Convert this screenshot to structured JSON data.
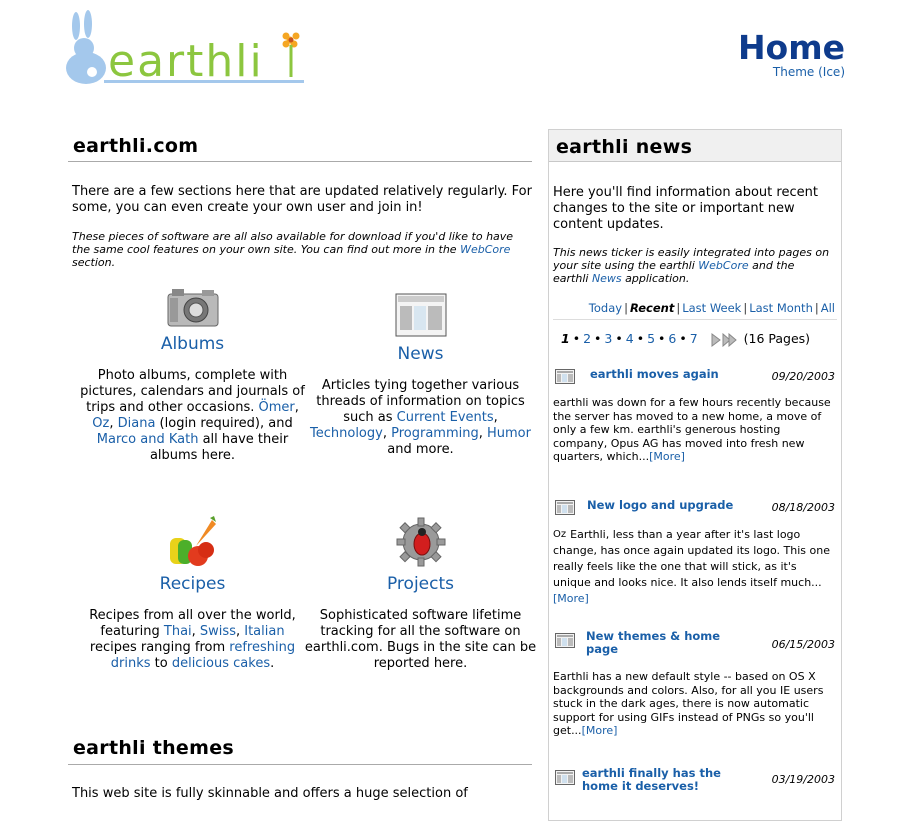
{
  "header": {
    "logo_text": "earthli",
    "page_title": "Home",
    "theme_link": "Theme (Ice)"
  },
  "main": {
    "title": "earthli.com",
    "intro": "There are a few sections here that are updated relatively regularly. For some, you can even create your own user and join in!",
    "note_before": "These pieces of software are all also available for download if you'd like to have the same cool features on your own site. You can find out more in the ",
    "note_link": "WebCore",
    "note_after": " section.",
    "tiles": [
      {
        "name": "Albums",
        "icon": "camera-icon",
        "desc_1": "Photo albums, complete with pictures, calendars and journals of trips and other occasions. ",
        "link_1": "Ömer",
        "sep_1": ", ",
        "link_2": "Oz",
        "sep_2": ", ",
        "link_3": "Diana",
        "desc_2": " (login required), and ",
        "link_4": "Marco and Kath",
        "desc_3": " all have their albums here."
      },
      {
        "name": "News",
        "icon": "newspaper-icon",
        "desc_1": "Articles tying together various threads of information on topics such as ",
        "link_1": "Current Events",
        "sep_1": ", ",
        "link_2": "Technology",
        "sep_2": ", ",
        "link_3": "Programming",
        "sep_3": ", ",
        "link_4": "Humor",
        "desc_2": " and more."
      },
      {
        "name": "Recipes",
        "icon": "vegetables-icon",
        "desc_1": "Recipes from all over the world, featuring ",
        "link_1": "Thai",
        "sep_1": ", ",
        "link_2": "Swiss",
        "sep_2": ", ",
        "link_3": "Italian",
        "desc_2": " recipes ranging from ",
        "link_4": "refreshing drinks",
        "desc_3": " to ",
        "link_5": "delicious cakes",
        "desc_4": "."
      },
      {
        "name": "Projects",
        "icon": "gear-bug-icon",
        "desc": "Sophisticated software lifetime tracking for all the software on earthli.com. Bugs in the site can be reported here."
      }
    ],
    "themes_title": "earthli themes",
    "themes_intro": "This web site is fully skinnable and offers a huge selection of"
  },
  "sidebar": {
    "title": "earthli news",
    "intro": "Here you'll find information about recent changes to the site or important new content updates.",
    "note_1": "This news ticker is easily integrated into pages on your site using the earthli ",
    "note_link_1": "WebCore",
    "note_2": " and the earthli ",
    "note_link_2": "News",
    "note_3": " application.",
    "filters": [
      "Today",
      "Recent",
      "Last Week",
      "Last Month",
      "All"
    ],
    "active_filter": "Recent",
    "pager": {
      "current": "1",
      "pages": [
        "2",
        "3",
        "4",
        "5",
        "6",
        "7"
      ],
      "total": "(16 Pages)"
    },
    "items": [
      {
        "title": "earthli moves again",
        "date": "09/20/2003",
        "body": "earthli was down for a few hours recently because the server has moved to a new home, a move of only a few km. earthli's generous hosting company, Opus AG has moved into fresh new quarters, which...",
        "more": "[More]"
      },
      {
        "title": "New logo and upgrade",
        "date": "08/18/2003",
        "author": "Oz",
        "body": "Earthli, less than a year after it's last logo change, has once again updated its logo. This one really feels like the one that will stick, as it's unique and looks nice. It also lends itself much...",
        "more": "[More]"
      },
      {
        "title": "New themes & home page",
        "date": "06/15/2003",
        "body": "Earthli has a new default style -- based on OS X backgrounds and colors. Also, for all you IE users stuck in the dark ages, there is now automatic support for using GIFs instead of PNGs so you'll get...",
        "more": "[More]"
      },
      {
        "title": "earthli finally has the home it deserves!",
        "date": "03/19/2003"
      }
    ]
  },
  "colors": {
    "link": "#1a5fa8",
    "title_blue": "#0e3b8c",
    "logo_blue": "#a4c8ec",
    "logo_green": "#8cc63f"
  }
}
